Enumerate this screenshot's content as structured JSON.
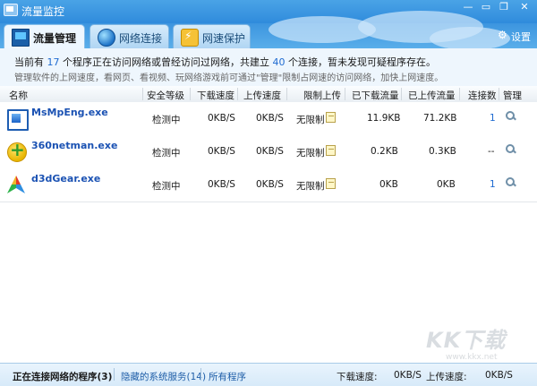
{
  "window": {
    "title": "流量监控",
    "controls": {
      "minimize": "—",
      "maximize": "▭",
      "restore": "❐",
      "close": "✕"
    }
  },
  "tabs": [
    {
      "label": "流量管理",
      "icon": "monitor-icon",
      "active": true
    },
    {
      "label": "网络连接",
      "icon": "globe-icon",
      "active": false
    },
    {
      "label": "网速保护",
      "icon": "speed-protect-icon",
      "active": false
    }
  ],
  "settings_label": "设置",
  "info": {
    "line1_prefix": "当前有 ",
    "program_count": "17",
    "line1_middle": " 个程序正在访问网络或曾经访问过网络，共建立 ",
    "connection_count": "40",
    "line1_suffix": " 个连接，暂未发现可疑程序存在。",
    "line2": "管理软件的上网速度，看网页、看视频、玩网络游戏前可通过\"管理\"限制占网速的访问网络，加快上网速度。"
  },
  "table": {
    "headers": {
      "name": "名称",
      "security": "安全等级",
      "down_speed": "下载速度",
      "up_speed": "上传速度",
      "limit_up": "限制上传",
      "downloaded": "已下载流量",
      "uploaded": "已上传流量",
      "connections": "连接数",
      "manage": "管理"
    },
    "rows": [
      {
        "name": "MsMpEng.exe",
        "icon": "msmpeng-icon",
        "security": "检测中",
        "down": "0KB/S",
        "up": "0KB/S",
        "limit": "无限制",
        "downloaded": "11.9KB",
        "uploaded": "71.2KB",
        "connections": "1"
      },
      {
        "name": "360netman.exe",
        "icon": "360-icon",
        "security": "检测中",
        "down": "0KB/S",
        "up": "0KB/S",
        "limit": "无限制",
        "downloaded": "0.2KB",
        "uploaded": "0.3KB",
        "connections": "--"
      },
      {
        "name": "d3dGear.exe",
        "icon": "d3dgear-icon",
        "security": "检测中",
        "down": "0KB/S",
        "up": "0KB/S",
        "limit": "无限制",
        "downloaded": "0KB",
        "uploaded": "0KB",
        "connections": "1"
      }
    ]
  },
  "statusbar": {
    "tab_connected": "正在连接网络的程序(3)",
    "tab_hidden": "隐藏的系统服务(14)",
    "tab_all": "所有程序",
    "down_label": "下载速度:",
    "down_value": "0KB/S",
    "up_label": "上传速度:",
    "up_value": "0KB/S"
  },
  "watermark": {
    "logo": "KK下载",
    "url": "www.kkx.net"
  },
  "colors": {
    "accent": "#2f8bdc",
    "link": "#1f6bd1",
    "app_name": "#1b52b3"
  }
}
